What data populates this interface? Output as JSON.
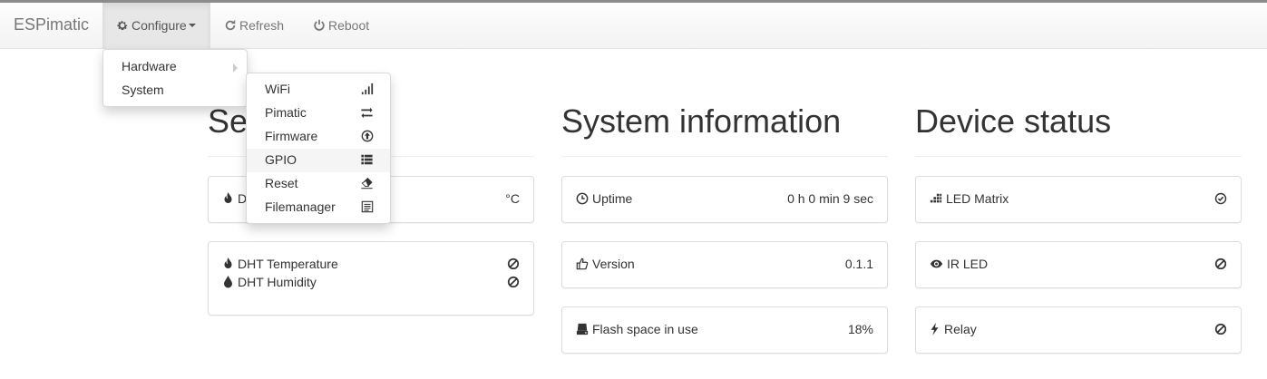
{
  "navbar": {
    "brand": "ESPimatic",
    "configure": {
      "label": "Configure",
      "icon": "gear-icon"
    },
    "refresh": {
      "label": "Refresh",
      "icon": "refresh-icon"
    },
    "reboot": {
      "label": "Reboot",
      "icon": "power-icon"
    }
  },
  "configure_menu": {
    "items": [
      {
        "label": "Hardware",
        "has_submenu": true
      },
      {
        "label": "System",
        "has_submenu": false
      }
    ]
  },
  "system_submenu": {
    "items": [
      {
        "label": "WiFi",
        "icon": "signal-icon"
      },
      {
        "label": "Pimatic",
        "icon": "transfer-icon"
      },
      {
        "label": "Firmware",
        "icon": "upload-circle-icon"
      },
      {
        "label": "GPIO",
        "icon": "list-icon",
        "highlighted": true
      },
      {
        "label": "Reset",
        "icon": "eraser-icon"
      },
      {
        "label": "Filemanager",
        "icon": "file-list-icon"
      }
    ]
  },
  "sensors": {
    "title_visible": "Se",
    "panel1": {
      "label_visible": "D",
      "value": "°C",
      "icon": "fire-icon"
    },
    "panel2": {
      "rows": [
        {
          "label": "DHT Temperature",
          "icon": "fire-icon",
          "status_icon": "ban-icon"
        },
        {
          "label": "DHT Humidity",
          "icon": "drop-icon",
          "status_icon": "ban-icon"
        }
      ]
    }
  },
  "system_information": {
    "title": "System information",
    "rows": [
      {
        "label": "Uptime",
        "value": "0 h 0 min 9 sec",
        "icon": "clock-icon"
      },
      {
        "label": "Version",
        "value": "0.1.1",
        "icon": "thumbs-up-icon"
      },
      {
        "label": "Flash space in use",
        "value": "18%",
        "icon": "hdd-icon"
      }
    ]
  },
  "device_status": {
    "title": "Device status",
    "rows": [
      {
        "label": "LED Matrix",
        "icon": "grid-icon",
        "status_icon": "check-circle-icon"
      },
      {
        "label": "IR LED",
        "icon": "eye-icon",
        "status_icon": "ban-icon"
      },
      {
        "label": "Relay",
        "icon": "bolt-icon",
        "status_icon": "ban-icon"
      }
    ]
  }
}
